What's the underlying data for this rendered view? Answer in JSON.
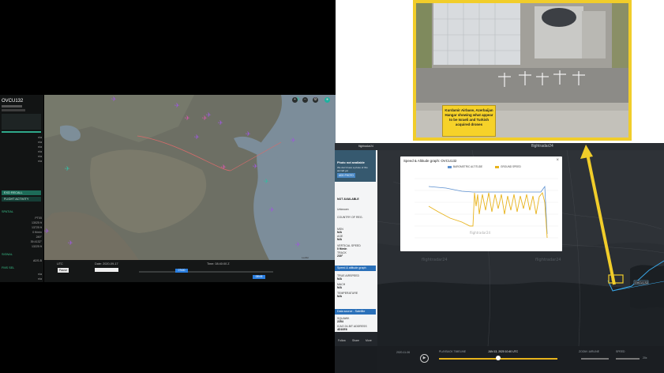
{
  "left_panel": {
    "flight_id": "OVCU132",
    "rows_top": [
      {
        "label": "",
        "value": ""
      }
    ],
    "stats": [
      {
        "label": "",
        "value": "n/a"
      },
      {
        "label": "",
        "value": "n/a"
      },
      {
        "label": "",
        "value": "n/a"
      },
      {
        "label": "",
        "value": "n/a"
      },
      {
        "label": "",
        "value": "n/a"
      },
      {
        "label": "",
        "value": "n/a"
      }
    ],
    "btn_recall": "EXD RECALL",
    "btn_flight_activity": "FLIGHT ACTIVITY",
    "section_spatial": "SPATIAL",
    "spatial_rows": [
      {
        "label": "",
        "value": "PT05"
      },
      {
        "label": "",
        "value": "13025 ft"
      },
      {
        "label": "",
        "value": "13725 ft"
      },
      {
        "label": "",
        "value": "0 ft/min"
      },
      {
        "label": "",
        "value": "249°"
      },
      {
        "label": "",
        "value": "39.4132°"
      },
      {
        "label": "",
        "value": "13225 ft"
      }
    ],
    "section_signal": "SIGNAL",
    "signal_rows": [
      {
        "label": "",
        "value": "ADS-B"
      }
    ],
    "section_fmsel": "FMS SEL",
    "fmsel_rows": [
      {
        "label": "",
        "value": "n/a"
      },
      {
        "label": "",
        "value": "n/a"
      }
    ]
  },
  "left_map": {
    "tools": [
      "+",
      "−",
      "⚙",
      "●"
    ],
    "scale": "Leaflet"
  },
  "left_bottom": {
    "utc_label": "UTC",
    "date_label": "Date: 2020-09-17",
    "time_label": "Time: 08:40:00 Z",
    "play": "Pause",
    "tl_marker_1": "07h00",
    "tl_marker_2": "08h45"
  },
  "airbase": {
    "caption": "Kurdamir Airbase, Azerbaijan Hangar showing what appear to be Israeli and Turkish acquired drones"
  },
  "fr_side": {
    "header": "flightradar24",
    "not_available": "Photo not available",
    "not_available_sub": "We don't have a photo of this aircraft yet",
    "add_photo": "ADD PHOTO",
    "nav": "NOT AVAILABLE",
    "fields": [
      {
        "label": "",
        "value": "N/A"
      },
      {
        "label": "",
        "value": "Unknown"
      },
      {
        "label": "COUNTRY OF REG.",
        "value": ""
      },
      {
        "label": "MSN",
        "value": "N/A"
      },
      {
        "label": "AGE",
        "value": "N/A"
      },
      {
        "label": "",
        "value": ""
      },
      {
        "label": "VERTICAL SPEED",
        "value": "0 ft/min"
      },
      {
        "label": "TRACK",
        "value": "230°"
      }
    ],
    "section_graph": "Speed & altitude graph",
    "graph_fields": [
      {
        "label": "TRUE AIRSPEED",
        "value": "N/A"
      },
      {
        "label": "MACH",
        "value": "N/A"
      },
      {
        "label": "TEMPERATURE",
        "value": "N/A"
      }
    ],
    "section_transponder": "Data source - Satellite transponder",
    "transponder_fields": [
      {
        "label": "SQUAWK",
        "value": "2254"
      },
      {
        "label": "ICAO 24-BIT ADDRESS",
        "value": "4D10E6"
      }
    ],
    "bottom_buttons": [
      "Follow",
      "Share",
      "More"
    ]
  },
  "fr_map": {
    "logo": "flightradar24",
    "flight_tag": "OVCU132",
    "watermark": "flightradar24"
  },
  "graph": {
    "title": "Speed & Altitude graph: OVCU132",
    "legend_alt": "BAROMETRIC ALTITUDE",
    "legend_speed": "GROUND SPEED",
    "logo": "flightradar24",
    "close": "×"
  },
  "fr_bottom": {
    "zoom_label": "ZOOM / AIRLINE",
    "speed_label": "SPEED",
    "playback_label": "PLAYBACK TIMELINE",
    "date": "JUN 13, 2020 10:40 UTC",
    "utc": "2020-11-06",
    "speed_value": "20x"
  },
  "colors": {
    "yellow": "#f1cd2a",
    "graph_alt": "#5a8fd0",
    "graph_speed": "#e8b31c",
    "fr_track": "#3aa7e8"
  },
  "chart_data": {
    "type": "line",
    "title": "Speed & Altitude graph: OVCU132",
    "series": [
      {
        "name": "BAROMETRIC ALTITUDE",
        "values": []
      },
      {
        "name": "GROUND SPEED",
        "values": []
      }
    ]
  }
}
